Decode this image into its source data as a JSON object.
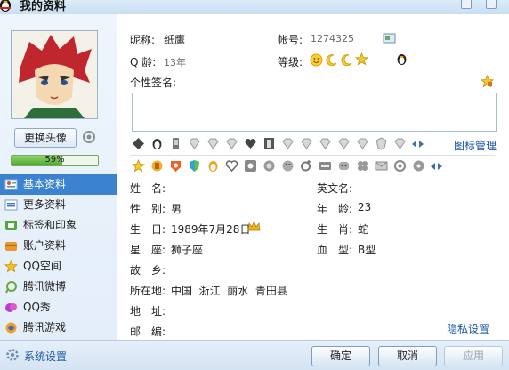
{
  "window": {
    "title": "我的资料"
  },
  "avatar": {
    "change_label": "更换头像",
    "completion_text": "59%",
    "completion": 0.59
  },
  "nav": {
    "items": [
      {
        "label": "基本资料",
        "icon": "profile-card-icon",
        "active": true
      },
      {
        "label": "更多资料",
        "icon": "more-info-icon"
      },
      {
        "label": "标签和印象",
        "icon": "tag-icon"
      },
      {
        "label": "账户资料",
        "icon": "account-icon"
      },
      {
        "label": "QQ空间",
        "icon": "star-icon"
      },
      {
        "label": "腾讯微博",
        "icon": "weibo-icon"
      },
      {
        "label": "QQ秀",
        "icon": "qqshow-icon"
      },
      {
        "label": "腾讯游戏",
        "icon": "game-icon"
      }
    ]
  },
  "profile": {
    "nickname_label": "昵称:",
    "nickname": "纸鹰",
    "account_label": "帐号:",
    "account": "1274325",
    "qage_label": "Q 龄:",
    "qage": "13年",
    "level_label": "等级:",
    "signature_label": "个性签名:",
    "icon_manage": "图标管理"
  },
  "fields": {
    "name_label": "姓　名:",
    "name": "",
    "english_name_label": "英文名:",
    "english_name": "",
    "gender_label": "性　别:",
    "gender": "男",
    "age_label": "年　龄:",
    "age": "23",
    "birthday_label": "生　日:",
    "birthday": "1989年7月28日",
    "zodiac_label": "生　肖:",
    "zodiac": "蛇",
    "constellation_label": "星　座:",
    "constellation": "狮子座",
    "blood_label": "血　型:",
    "blood": "B型",
    "hometown_label": "故　乡:",
    "hometown": "",
    "location_label": "所在地:",
    "location": "中国  浙江  丽水  青田县",
    "address_label": "地　址:",
    "address": "",
    "postcode_label": "邮　编:",
    "postcode": ""
  },
  "privacy_link": "隐私设置",
  "footer": {
    "system_settings": "系统设置",
    "ok": "确定",
    "cancel": "取消",
    "apply": "应用"
  },
  "colors": {
    "accent": "#3b82d1",
    "link": "#1d59a6",
    "progress": "#4fa62d"
  }
}
